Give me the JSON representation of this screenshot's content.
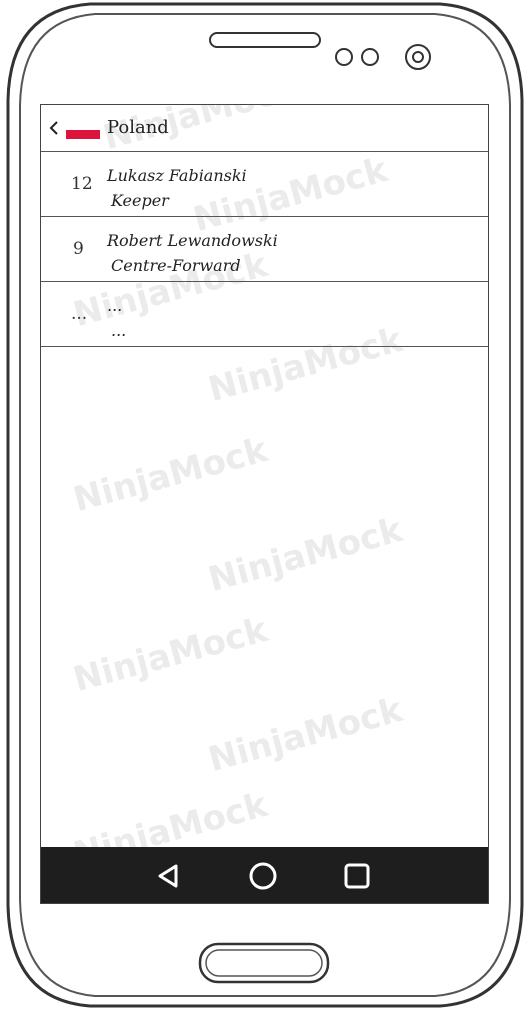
{
  "app": {
    "title": "Poland",
    "flag_colors": {
      "top": "#ffffff",
      "bottom": "#dc143c"
    }
  },
  "players": [
    {
      "number": "12",
      "name": "Lukasz Fabianski",
      "position": "Keeper"
    },
    {
      "number": "9",
      "name": "Robert Lewandowski",
      "position": "Centre-Forward"
    },
    {
      "number": "...",
      "name": "...",
      "position": "..."
    }
  ],
  "watermark": "NinjaMock",
  "navbar": {
    "icons": [
      "back-triangle-icon",
      "home-circle-icon",
      "recents-square-icon"
    ],
    "background": "#1e1e1e"
  }
}
